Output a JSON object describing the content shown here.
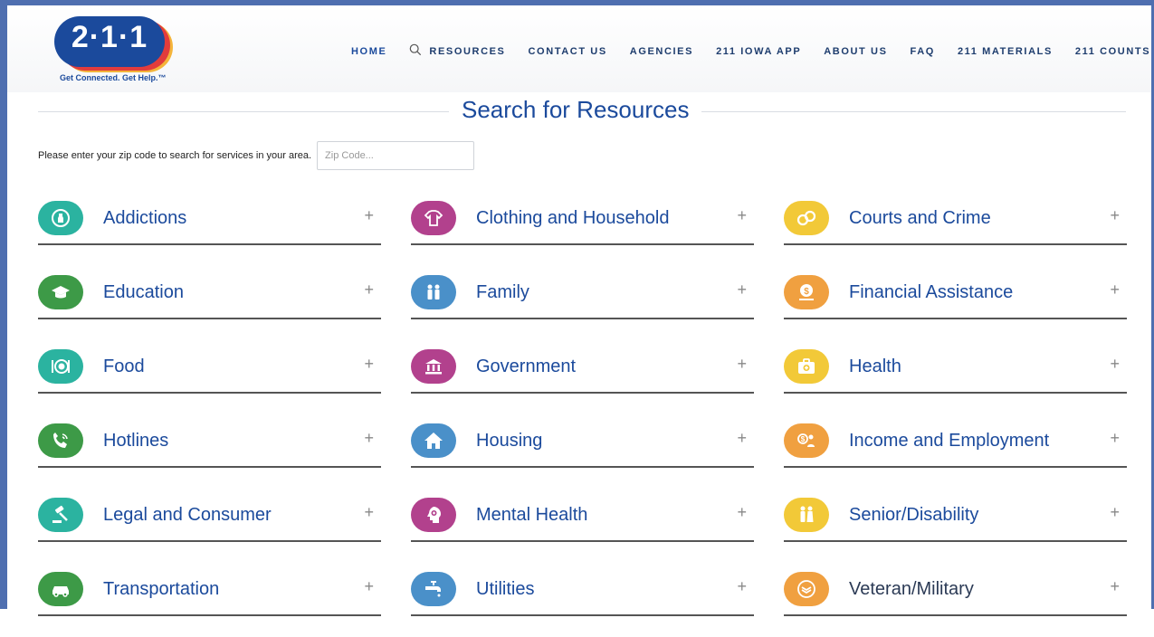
{
  "brand": {
    "logo_text": "2·1·1",
    "tagline": "Get Connected. Get Help.™"
  },
  "nav": [
    {
      "label": "HOME",
      "icon": "",
      "active": true
    },
    {
      "label": "RESOURCES",
      "icon": "search-icon",
      "active": false
    },
    {
      "label": "CONTACT US",
      "icon": "",
      "active": false
    },
    {
      "label": "AGENCIES",
      "icon": "",
      "active": false
    },
    {
      "label": "211 IOWA APP",
      "icon": "",
      "active": false
    },
    {
      "label": "ABOUT US",
      "icon": "",
      "active": false
    },
    {
      "label": "FAQ",
      "icon": "",
      "active": false
    },
    {
      "label": "211 MATERIALS",
      "icon": "",
      "active": false
    },
    {
      "label": "211 COUNTS",
      "icon": "",
      "active": false
    }
  ],
  "page_title": "Search for Resources",
  "zip": {
    "label": "Please enter your zip code to search for services in your area.",
    "placeholder": "Zip Code...",
    "value": ""
  },
  "expand_symbol": "+",
  "categories": [
    {
      "label": "Addictions",
      "color": "#2bb3a0",
      "icon": "bottle-icon"
    },
    {
      "label": "Clothing and Household",
      "color": "#b2418d",
      "icon": "shirt-icon"
    },
    {
      "label": "Courts and Crime",
      "color": "#f2c938",
      "icon": "handcuffs-icon"
    },
    {
      "label": "Education",
      "color": "#3d9a47",
      "icon": "graduation-cap-icon"
    },
    {
      "label": "Family",
      "color": "#4a90c9",
      "icon": "family-icon"
    },
    {
      "label": "Financial Assistance",
      "color": "#f0a040",
      "icon": "money-hand-icon"
    },
    {
      "label": "Food",
      "color": "#2bb3a0",
      "icon": "plate-icon"
    },
    {
      "label": "Government",
      "color": "#b2418d",
      "icon": "building-icon"
    },
    {
      "label": "Health",
      "color": "#f2c938",
      "icon": "medkit-icon"
    },
    {
      "label": "Hotlines",
      "color": "#3d9a47",
      "icon": "phone-icon"
    },
    {
      "label": "Housing",
      "color": "#4a90c9",
      "icon": "house-icon"
    },
    {
      "label": "Income and Employment",
      "color": "#f0a040",
      "icon": "income-icon"
    },
    {
      "label": "Legal and Consumer",
      "color": "#2bb3a0",
      "icon": "gavel-icon"
    },
    {
      "label": "Mental Health",
      "color": "#b2418d",
      "icon": "head-icon"
    },
    {
      "label": "Senior/Disability",
      "color": "#f2c938",
      "icon": "senior-icon"
    },
    {
      "label": "Transportation",
      "color": "#3d9a47",
      "icon": "car-icon"
    },
    {
      "label": "Utilities",
      "color": "#4a90c9",
      "icon": "faucet-icon"
    },
    {
      "label": "Veteran/Military",
      "color": "#f0a040",
      "icon": "badge-icon"
    }
  ]
}
